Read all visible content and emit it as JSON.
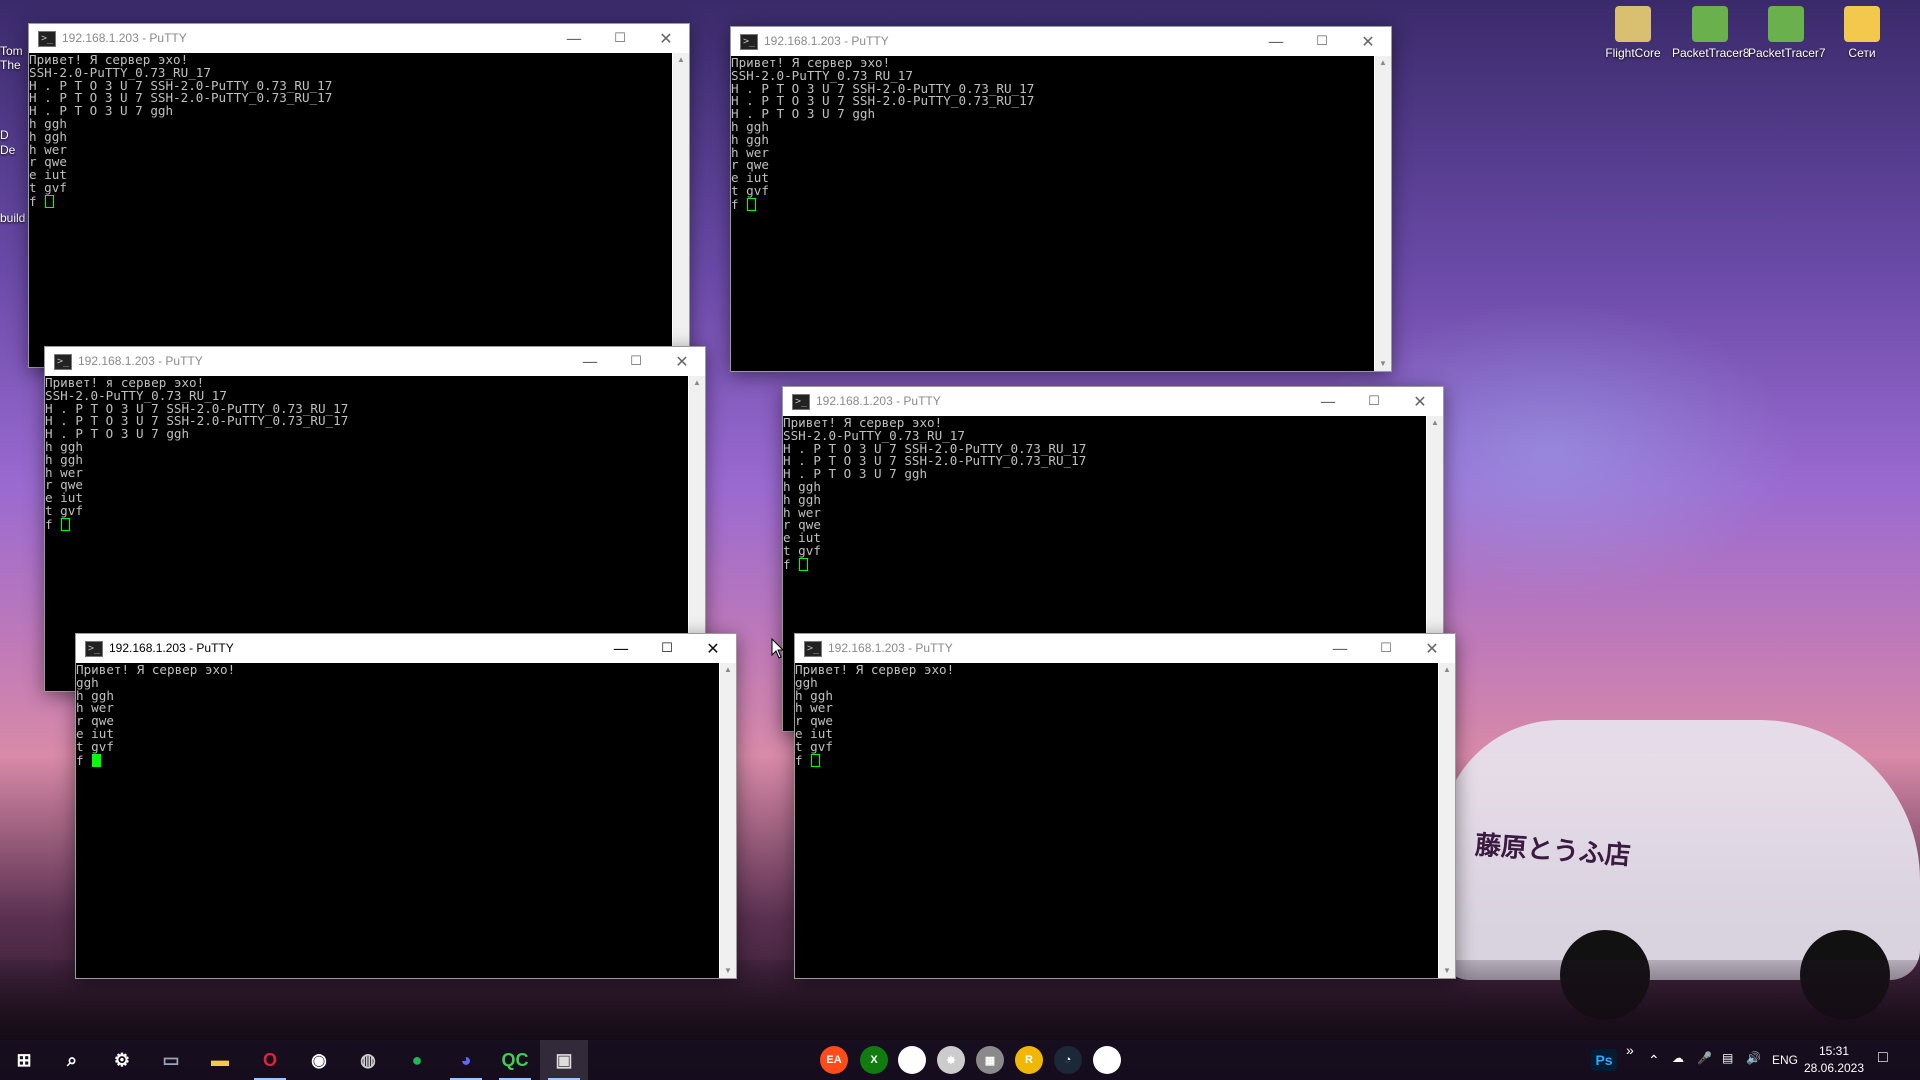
{
  "desktop": {
    "icons": [
      {
        "label": "FlightCore",
        "color": "#e0c060"
      },
      {
        "label": "PacketTracer8",
        "color": "#6ab04c"
      },
      {
        "label": "PacketTracer7",
        "color": "#6ab04c"
      },
      {
        "label": "Сети",
        "color": "#f2c94c"
      }
    ],
    "left_fragments": [
      "Tom",
      "The",
      "D",
      "De",
      "build"
    ],
    "car_text": "藤原とうふ店"
  },
  "windows": [
    {
      "title": "192.168.1.203 - PuTTY",
      "active": false,
      "lines": [
        "Привет! Я сервер эхо!",
        "SSH-2.0-PuTTY_0.73_RU_17",
        "H . P T O 3 U 7 SSH-2.0-PuTTY_0.73_RU_17",
        "H . P T O 3 U 7 SSH-2.0-PuTTY_0.73_RU_17",
        "H . P T O 3 U 7 ggh",
        "h ggh",
        "h ggh",
        "h wer",
        "r qwe",
        "e iut",
        "t gvf"
      ],
      "prompt": "f "
    },
    {
      "title": "192.168.1.203 - PuTTY",
      "active": false,
      "lines": [
        "Привет! Я сервер эхо!",
        "SSH-2.0-PuTTY_0.73_RU_17",
        "H . P T O 3 U 7 SSH-2.0-PuTTY_0.73_RU_17",
        "H . P T O 3 U 7 SSH-2.0-PuTTY_0.73_RU_17",
        "H . P T O 3 U 7 ggh",
        "h ggh",
        "h ggh",
        "h wer",
        "r qwe",
        "e iut",
        "t gvf"
      ],
      "prompt": "f "
    },
    {
      "title": "192.168.1.203 - PuTTY",
      "active": false,
      "lines": [
        "Привет! я сервер эхо!",
        "SSH-2.0-PuTTY_0.73_RU_17",
        "H . P T O 3 U 7 SSH-2.0-PuTTY_0.73_RU_17",
        "H . P T O 3 U 7 SSH-2.0-PuTTY_0.73_RU_17",
        "H . P T O 3 U 7 ggh",
        "h ggh",
        "h ggh",
        "h wer",
        "r qwe",
        "e iut",
        "t gvf"
      ],
      "prompt": "f "
    },
    {
      "title": "192.168.1.203 - PuTTY",
      "active": false,
      "lines": [
        "Привет! Я сервер эхо!",
        "SSH-2.0-PuTTY_0.73_RU_17",
        "H . P T O 3 U 7 SSH-2.0-PuTTY_0.73_RU_17",
        "H . P T O 3 U 7 SSH-2.0-PuTTY_0.73_RU_17",
        "H . P T O 3 U 7 ggh",
        "h ggh",
        "h ggh",
        "h wer",
        "r qwe",
        "e iut",
        "t gvf"
      ],
      "prompt": "f "
    },
    {
      "title": "192.168.1.203 - PuTTY",
      "active": true,
      "lines": [
        "Привет! Я сервер эхо!",
        "ggh",
        "h ggh",
        "h wer",
        "r qwe",
        "e iut",
        "t gvf"
      ],
      "prompt": "f "
    },
    {
      "title": "192.168.1.203 - PuTTY",
      "active": false,
      "lines": [
        "Привет! Я сервер эхо!",
        "ggh",
        "h ggh",
        "h wer",
        "r qwe",
        "e iut",
        "t gvf"
      ],
      "prompt": "f "
    }
  ],
  "taskbar": {
    "apps": [
      {
        "name": "windows-start-icon",
        "glyph": "⊞",
        "color": "#ffffff"
      },
      {
        "name": "search-icon",
        "glyph": "⌕",
        "color": "#ffffff"
      },
      {
        "name": "settings-icon",
        "glyph": "⚙",
        "color": "#ffffff"
      },
      {
        "name": "file-explorer-alt-icon",
        "glyph": "▭",
        "color": "#9aa4b8"
      },
      {
        "name": "folder-icon",
        "glyph": "▬",
        "color": "#f2c94c"
      },
      {
        "name": "opera-icon",
        "glyph": "O",
        "color": "#e0233a"
      },
      {
        "name": "app-icon",
        "glyph": "◉",
        "color": "#ffffff"
      },
      {
        "name": "obs-icon",
        "glyph": "◍",
        "color": "#cccccc"
      },
      {
        "name": "spotify-icon",
        "glyph": "●",
        "color": "#1db954"
      },
      {
        "name": "messenger-icon",
        "glyph": "◕",
        "color": "#5b6bff"
      },
      {
        "name": "qt-creator-icon",
        "glyph": "QC",
        "color": "#41cd52"
      },
      {
        "name": "putty-icon",
        "glyph": "▣",
        "color": "#dddddd"
      }
    ],
    "center_apps": [
      {
        "name": "ea-icon",
        "glyph": "EA",
        "color": "#ff4a1a"
      },
      {
        "name": "xbox-icon",
        "glyph": "X",
        "color": "#107c10"
      },
      {
        "name": "destiny-icon",
        "glyph": "Ψ",
        "color": "#ffffff"
      },
      {
        "name": "witcher-icon",
        "glyph": "✸",
        "color": "#cccccc"
      },
      {
        "name": "game-icon",
        "glyph": "▦",
        "color": "#8a8a8a"
      },
      {
        "name": "rockstar-icon",
        "glyph": "R",
        "color": "#f2b705"
      },
      {
        "name": "steam-icon",
        "glyph": "◔",
        "color": "#1b2838"
      },
      {
        "name": "ubisoft-icon",
        "glyph": "◎",
        "color": "#ffffff"
      }
    ],
    "tray": {
      "ps_label": "Ps",
      "chevron": "»",
      "lang": "ENG",
      "time": "15:31",
      "date": "28.06.2023"
    }
  }
}
